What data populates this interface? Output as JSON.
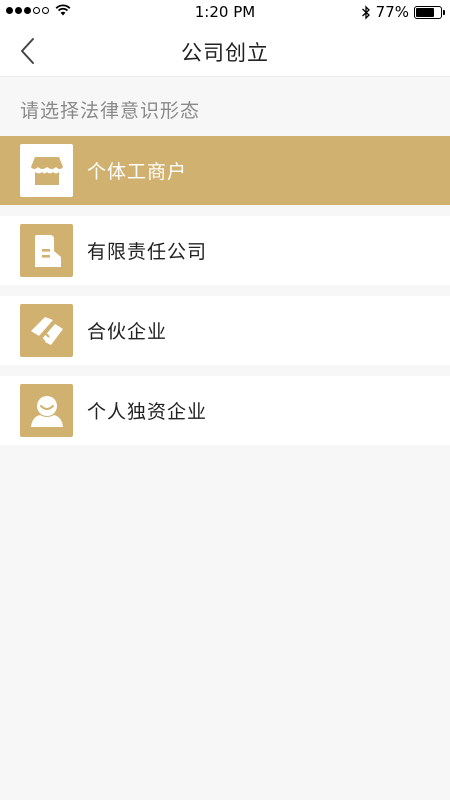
{
  "status_bar": {
    "time": "1:20 PM",
    "battery_percent": "77%",
    "battery_level": 0.77,
    "signal_dots_filled": 3,
    "signal_dots_total": 5
  },
  "nav": {
    "title": "公司创立",
    "back_icon": "chevron-left-icon"
  },
  "section": {
    "label": "请选择法律意识形态"
  },
  "options": [
    {
      "label": "个体工商户",
      "icon": "store-icon",
      "selected": true
    },
    {
      "label": "有限责任公司",
      "icon": "building-icon",
      "selected": false
    },
    {
      "label": "合伙企业",
      "icon": "handshake-icon",
      "selected": false
    },
    {
      "label": "个人独资企业",
      "icon": "person-icon",
      "selected": false
    }
  ],
  "colors": {
    "accent": "#d0b16f",
    "background": "#f7f7f7",
    "card": "#ffffff",
    "text": "#222222",
    "muted_text": "#8a8a8a"
  }
}
